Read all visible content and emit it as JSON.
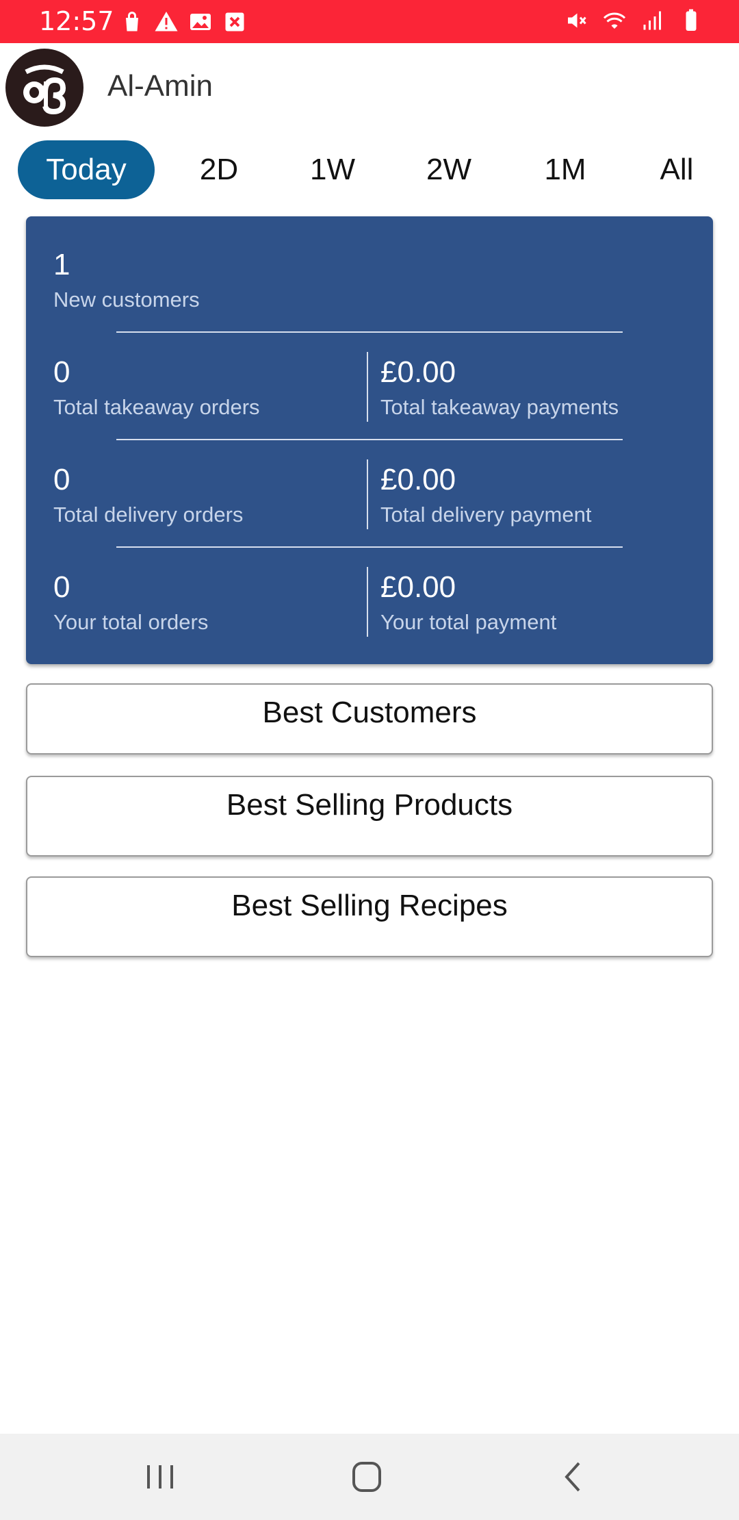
{
  "status_bar": {
    "time": "12:57",
    "left_icons": [
      "shopping-bag-icon",
      "warning-icon",
      "image-icon",
      "close-box-icon"
    ],
    "right_icons": [
      "mute-icon",
      "wifi-icon",
      "signal-icon",
      "battery-icon"
    ],
    "background": "#fb2537"
  },
  "header": {
    "user_name": "Al-Amin",
    "avatar_icon": "logo-avatar-icon"
  },
  "tabs": [
    {
      "label": "Today",
      "active": true
    },
    {
      "label": "2D",
      "active": false
    },
    {
      "label": "1W",
      "active": false
    },
    {
      "label": "2W",
      "active": false
    },
    {
      "label": "1M",
      "active": false
    },
    {
      "label": "All",
      "active": false
    }
  ],
  "summary": {
    "background": "#2f5289",
    "new_customers": {
      "value": "1",
      "label": "New customers"
    },
    "takeaway_orders": {
      "value": "0",
      "label": "Total takeaway orders"
    },
    "takeaway_payments": {
      "value": "£0.00",
      "label": "Total takeaway payments"
    },
    "delivery_orders": {
      "value": "0",
      "label": "Total delivery orders"
    },
    "delivery_payment": {
      "value": "£0.00",
      "label": "Total delivery payment"
    },
    "total_orders": {
      "value": "0",
      "label": "Your total orders"
    },
    "total_payment": {
      "value": "£0.00",
      "label": "Your total payment"
    }
  },
  "buttons": {
    "best_customers": "Best Customers",
    "best_selling_products": "Best Selling Products",
    "best_selling_recipes": "Best Selling Recipes"
  },
  "navbar": {
    "icons": [
      "recent-apps-icon",
      "home-icon",
      "back-icon"
    ]
  },
  "colors": {
    "active_tab": "#0d6296",
    "card": "#2f5289"
  }
}
